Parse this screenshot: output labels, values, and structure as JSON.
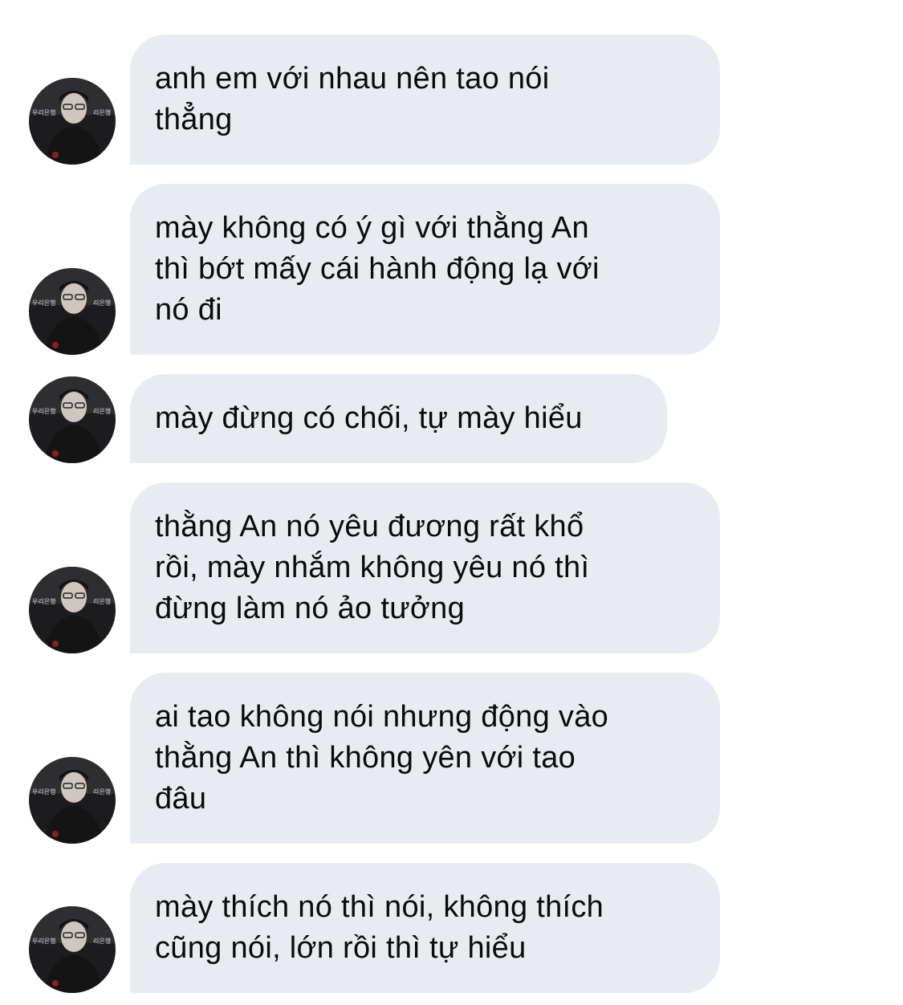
{
  "conversation": {
    "messages": [
      {
        "text": "anh em với nhau nên tao nói\nthẳng"
      },
      {
        "text": "mày không có ý gì với thằng An\nthì bớt mấy cái hành động lạ với\nnó đi"
      },
      {
        "text": "mày đừng có chối, tự mày hiểu"
      },
      {
        "text": "thằng An nó yêu đương rất khổ\nrồi, mày nhắm không yêu nó thì\nđừng làm nó ảo tưởng"
      },
      {
        "text": "ai tao không nói nhưng động vào\nthằng An thì không yên với tao\nđâu"
      },
      {
        "text": "mày thích nó thì nói, không thích\ncũng nói, lớn rồi thì tự hiểu"
      }
    ]
  },
  "colors": {
    "bubble_background": "#e8ecf0",
    "text": "#0b0b0b",
    "page_background": "#ffffff"
  },
  "icons": {
    "avatar": "user-avatar-photo"
  }
}
